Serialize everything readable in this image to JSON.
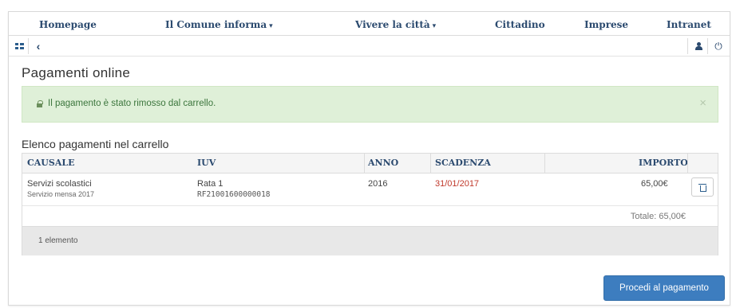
{
  "topnav": {
    "items": [
      {
        "label": "Homepage"
      },
      {
        "label": "Il Comune informa",
        "caret": "▾"
      },
      {
        "label": "Vivere la città",
        "caret": "▾"
      },
      {
        "label": "Cittadino"
      },
      {
        "label": "Imprese"
      },
      {
        "label": "Intranet"
      }
    ]
  },
  "toolbar": {
    "icons": [
      "grid-icon",
      "chevron-left-icon",
      "user-icon",
      "power-icon"
    ]
  },
  "page": {
    "title": "Pagamenti online"
  },
  "alert": {
    "message": "Il pagamento è stato rimosso dal carrello.",
    "close": "×",
    "color": "#dff0d8"
  },
  "cart": {
    "title": "Elenco pagamenti nel carrello",
    "columns": [
      "CAUSALE",
      "IUV",
      "ANNO",
      "SCADENZA",
      "IMPORTO"
    ],
    "rows": [
      {
        "causale": "Servizi scolastici",
        "causale_sub": "Servizio mensa 2017",
        "iuv": "Rata 1",
        "iuv_sub": "RF21001600000018",
        "anno": "2016",
        "scadenza": "31/01/2017",
        "importo": "65,00€"
      }
    ],
    "total": "Totale: 65,00€",
    "count": "1 elemento"
  },
  "actions": {
    "proceed": "Procedi al pagamento"
  },
  "colors": {
    "primary": "#3d7dbf",
    "nav_text": "#2b4a6f",
    "due_date": "#c0392b"
  }
}
